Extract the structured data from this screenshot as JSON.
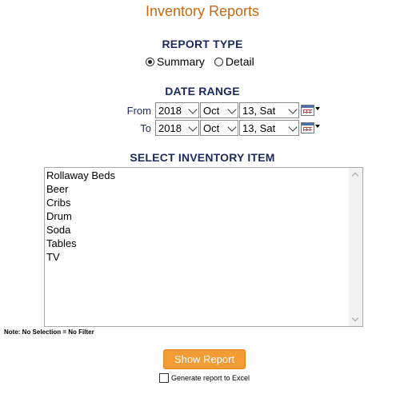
{
  "title": "Inventory Reports",
  "report_type": {
    "label": "REPORT TYPE",
    "options": [
      {
        "label": "Summary",
        "checked": true
      },
      {
        "label": "Detail",
        "checked": false
      }
    ]
  },
  "date_range": {
    "label": "DATE RANGE",
    "from": {
      "label": "From",
      "year": "2018",
      "month": "Oct",
      "day": "13, Sat"
    },
    "to": {
      "label": "To",
      "year": "2018",
      "month": "Oct",
      "day": "13, Sat"
    }
  },
  "inventory": {
    "label": "SELECT INVENTORY ITEM",
    "items": [
      "Rollaway Beds",
      "Beer",
      "Cribs",
      "Drum",
      "Soda",
      "Tables",
      "TV"
    ]
  },
  "note": "Note: No Selection = No Filter",
  "show_report_label": "Show Report",
  "excel": {
    "label": "Generate report to Excel",
    "checked": false
  },
  "colors": {
    "title": "#c46a14",
    "button": "#f39c35",
    "labels": "#1c2a5b"
  }
}
